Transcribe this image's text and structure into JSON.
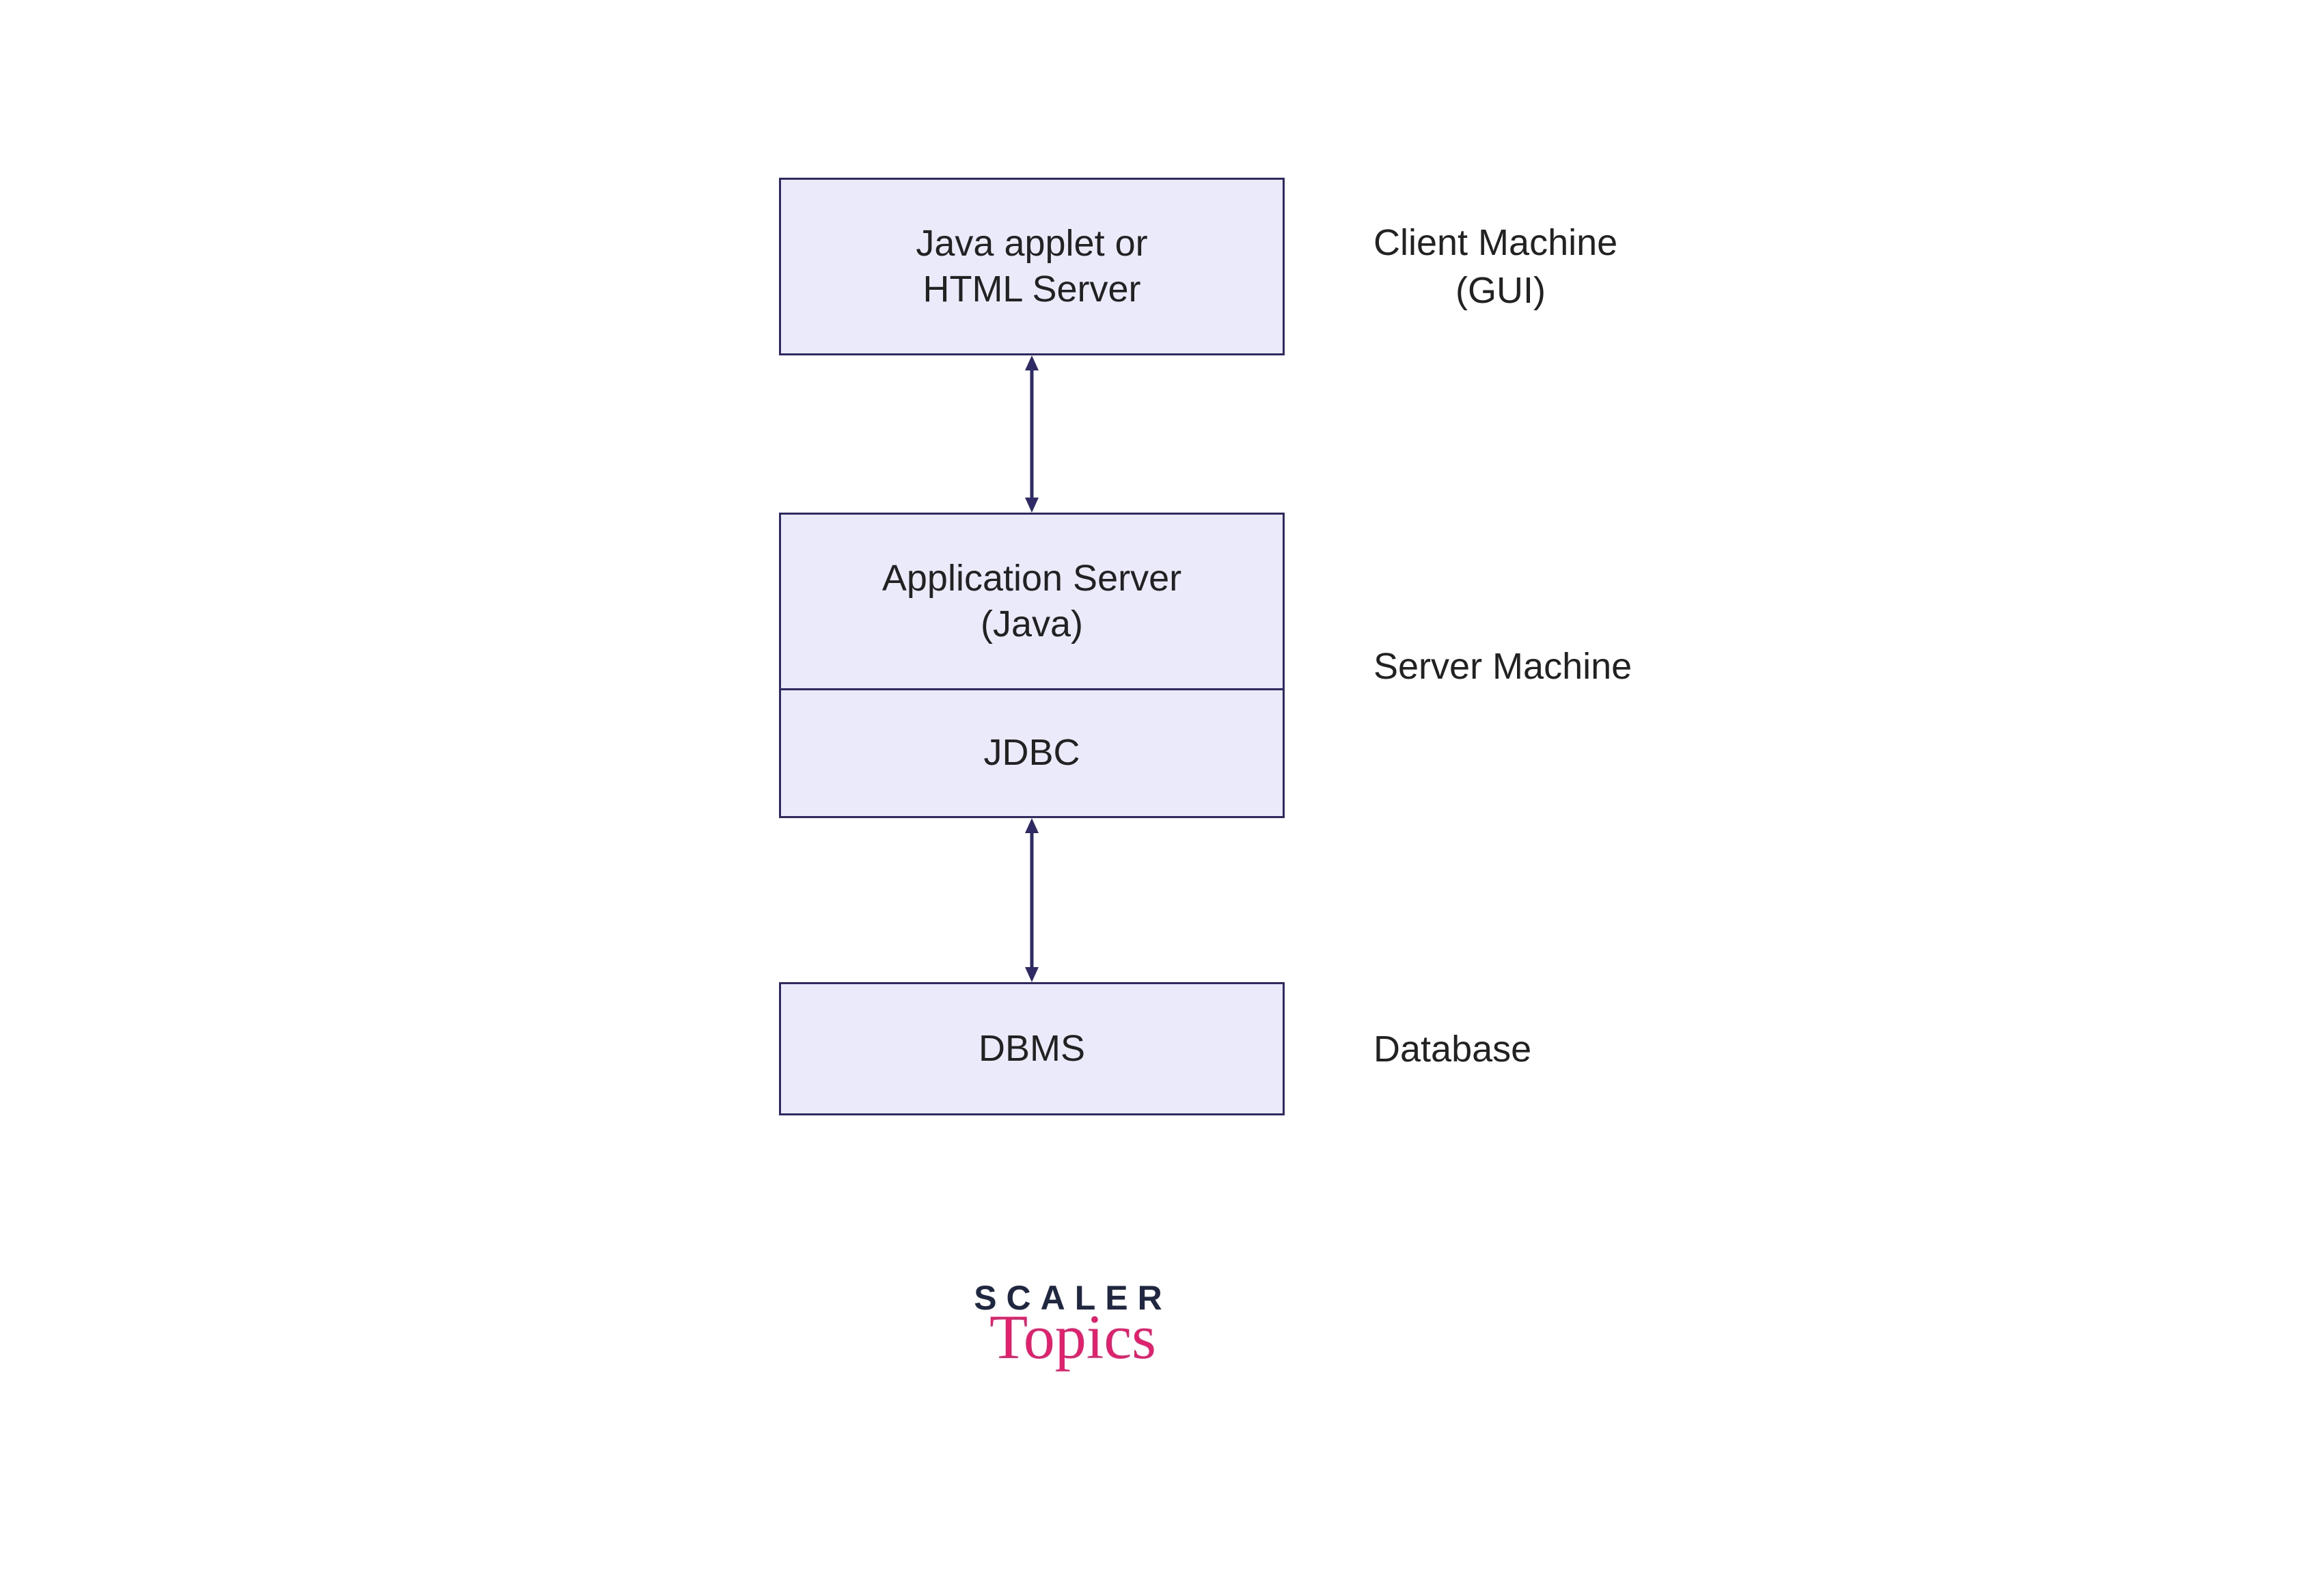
{
  "boxes": {
    "client": {
      "line1": "Java applet or",
      "line2": "HTML Server"
    },
    "appserver": {
      "line1": "Application Server",
      "line2": "(Java)"
    },
    "jdbc": "JDBC",
    "dbms": "DBMS"
  },
  "labels": {
    "client": {
      "line1": "Client Machine",
      "line2": "(GUI)"
    },
    "server": "Server Machine",
    "database": "Database"
  },
  "logo": {
    "top": "SCALER",
    "bottom": "Topics"
  }
}
